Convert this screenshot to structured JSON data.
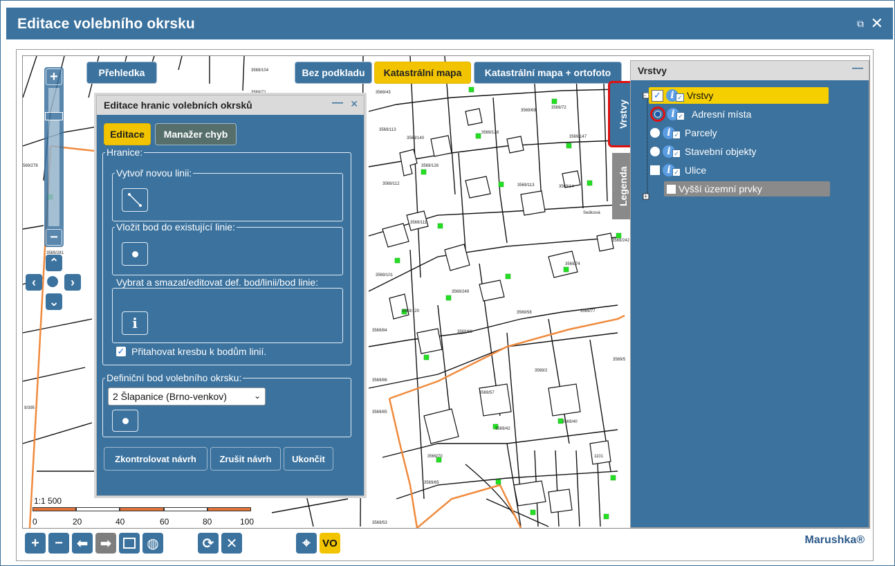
{
  "window": {
    "title": "Editace volebního okrsku",
    "external_icon": "external-link-icon",
    "close_icon": "close-icon"
  },
  "basemap": {
    "overview_label": "Přehledka",
    "options": [
      {
        "label": "Bez podkladu",
        "active": false
      },
      {
        "label": "Katastrální mapa",
        "active": true
      },
      {
        "label": "Katastrální mapa + ortofoto",
        "active": false
      }
    ]
  },
  "edit_panel": {
    "title": "Editace hranic volebních okrsků",
    "tabs": [
      {
        "label": "Editace",
        "active": true
      },
      {
        "label": "Manažer chyb",
        "active": false
      }
    ],
    "hranice_label": "Hranice:",
    "create_line_label": "Vytvoř novou linii:",
    "insert_point_label": "Vložit bod do existující linie:",
    "select_delete_label": "Vybrat a smazat/editovat def. bod/linii/bod linie:",
    "snap_label": "Přitahovat kresbu k bodům linií.",
    "snap_checked": true,
    "definition_point_label": "Definiční bod volebního okrsku:",
    "district_select": "2 Šlapanice (Brno-venkov)",
    "buttons": {
      "check": "Zkontrolovat návrh",
      "cancel": "Zrušit návrh",
      "finish": "Ukončit"
    }
  },
  "layers_panel": {
    "title": "Vrstvy",
    "tab_layers": "Vrstvy",
    "tab_legend": "Legenda",
    "items": [
      {
        "label": "Vrstvy",
        "control": "checkbox-checked"
      },
      {
        "label": "Adresní místa",
        "control": "radio-selected"
      },
      {
        "label": "Parcely",
        "control": "radio"
      },
      {
        "label": "Stavební objekty",
        "control": "radio"
      },
      {
        "label": "Ulice",
        "control": "checkbox"
      },
      {
        "label": "Vyšší územní prvky",
        "control": "checkbox"
      }
    ]
  },
  "scale": {
    "ratio": "1:1 500",
    "ticks": [
      "0",
      "20",
      "40",
      "60",
      "80",
      "100 m"
    ]
  },
  "toolbar": {
    "vo_label": "VO",
    "icons": [
      "plus-icon",
      "minus-icon",
      "arrow-left-icon",
      "arrow-right-icon",
      "zoom-extent-icon",
      "globe-icon",
      "refresh-icon",
      "close-icon",
      "locate-icon"
    ]
  },
  "brand": "Marushka®",
  "map_labels": [
    "3569/104",
    "3569/71",
    "3569/43",
    "3569/69",
    "3569/72",
    "3569/113",
    "3569/140",
    "3569/128",
    "3569/147",
    "3569/112",
    "3569/126",
    "3569/113",
    "3569/111",
    "3569/101",
    "3569/242",
    "3569/74",
    "3569/249",
    "3569/84",
    "3569/120",
    "3569/68",
    "3569/58",
    "3569/77",
    "3569/86",
    "3569/57",
    "3569/2",
    "3569/5",
    "3569/85",
    "3569/42",
    "3569/40",
    "3569/70",
    "3569/65",
    "3569/53",
    "Sedlcová",
    "1101",
    "9/395",
    "3569/281"
  ],
  "colors": {
    "panel_blue": "#3b729e",
    "active_yellow": "#f2c400",
    "highlight_red": "#e01010",
    "boundary_orange": "#f08a3c",
    "address_green": "#22e022"
  }
}
